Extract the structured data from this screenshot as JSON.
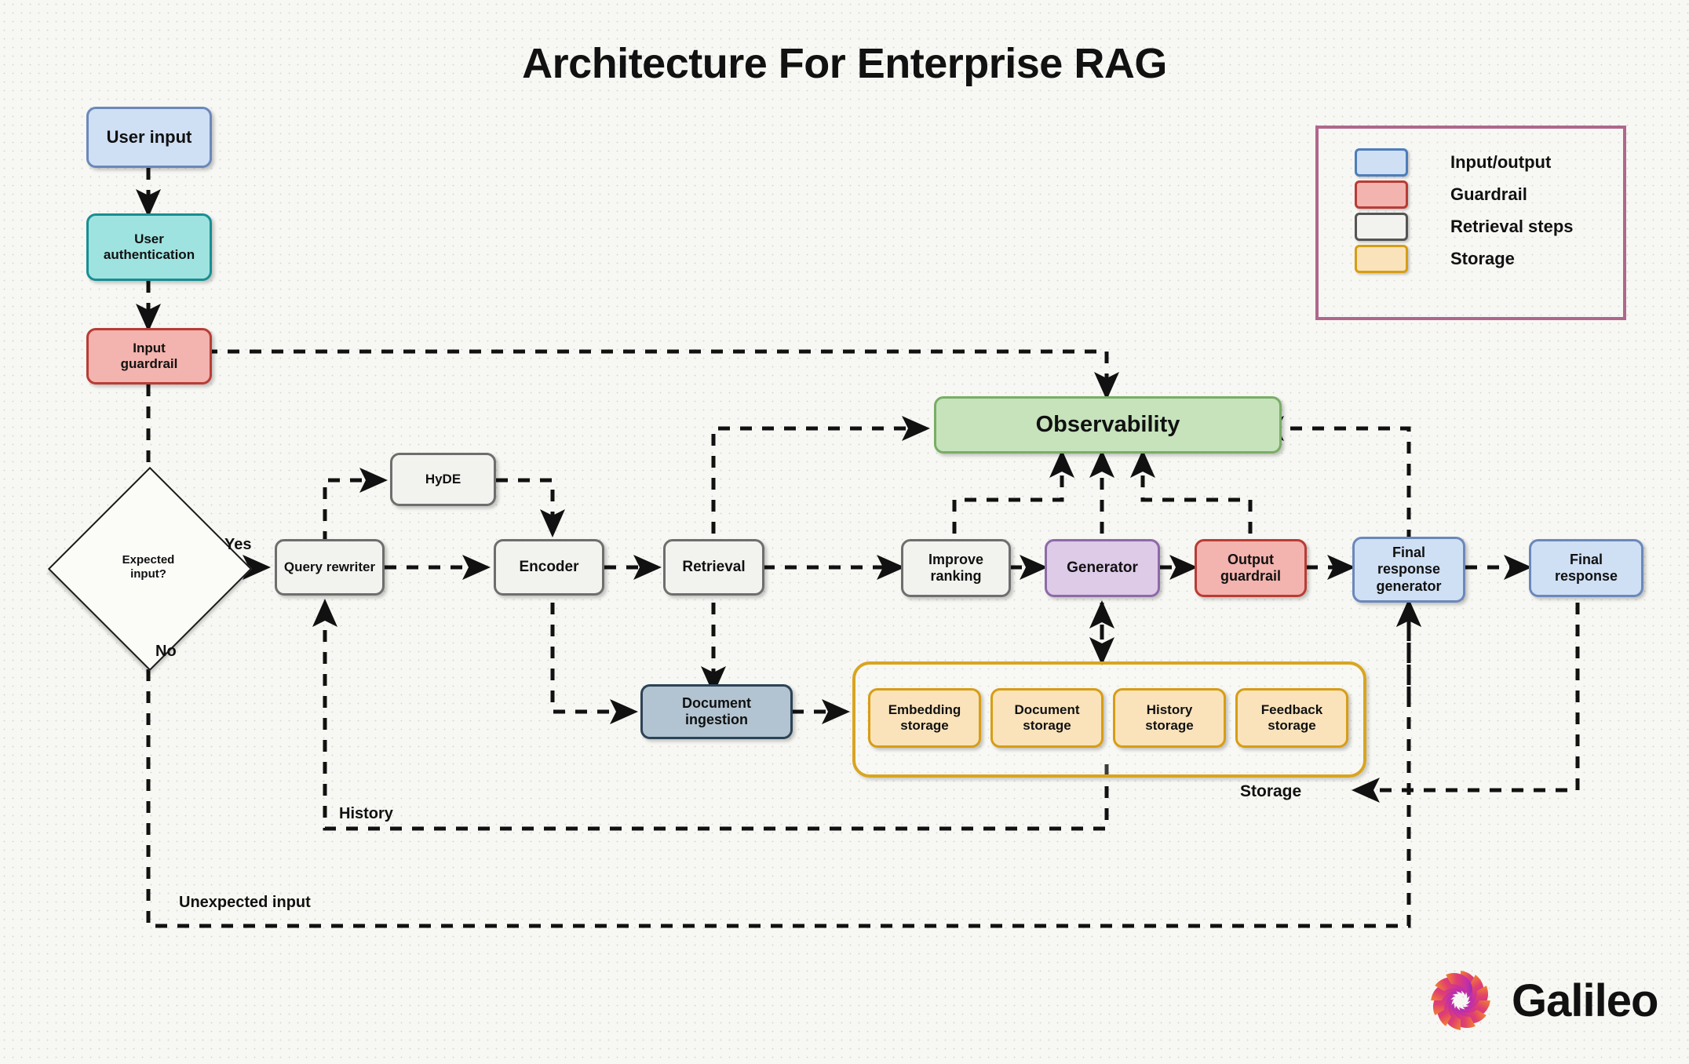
{
  "title": "Architecture For Enterprise RAG",
  "nodes": {
    "user_input": "User input",
    "user_authentication": "User\nauthentication",
    "input_guardrail": "Input\nguardrail",
    "expected_input": "Expected\ninput?",
    "query_rewriter": "Query rewriter",
    "hyde": "HyDE",
    "encoder": "Encoder",
    "retrieval": "Retrieval",
    "improve_ranking": "Improve\nranking",
    "generator": "Generator",
    "output_guardrail": "Output\nguardrail",
    "final_response_generator": "Final\nresponse\ngenerator",
    "final_response": "Final\nresponse",
    "observability": "Observability",
    "document_ingestion": "Document\ningestion",
    "embedding_storage": "Embedding\nstorage",
    "document_storage": "Document\nstorage",
    "history_storage": "History\nstorage",
    "feedback_storage": "Feedback\nstorage",
    "storage_group": "Storage"
  },
  "edge_labels": {
    "yes": "Yes",
    "no": "No",
    "history": "History",
    "unexpected_input": "Unexpected input"
  },
  "legend": {
    "rows": [
      {
        "label": "Input/output",
        "fill": "#cfe0f5",
        "stroke": "#4c7ebb"
      },
      {
        "label": "Guardrail",
        "fill": "#f3b3ae",
        "stroke": "#b83c35"
      },
      {
        "label": "Retrieval steps",
        "fill": "#f2f2ef",
        "stroke": "#555555"
      },
      {
        "label": "Storage",
        "fill": "#fae3bb",
        "stroke": "#d79d15"
      }
    ]
  },
  "brand": {
    "name": "Galileo"
  },
  "colors": {
    "background": "#f7f7f3",
    "io": "#cfe0f5",
    "auth": "#9fe3e0",
    "guardrail": "#f3b3ae",
    "retrieval_step": "#f2f2ef",
    "observability": "#c6e3bc",
    "generator": "#ddcbe8",
    "ingestion": "#b2c4d1",
    "storage": "#fae3bb",
    "legend_border": "#b0678c",
    "wire": "#111111"
  }
}
